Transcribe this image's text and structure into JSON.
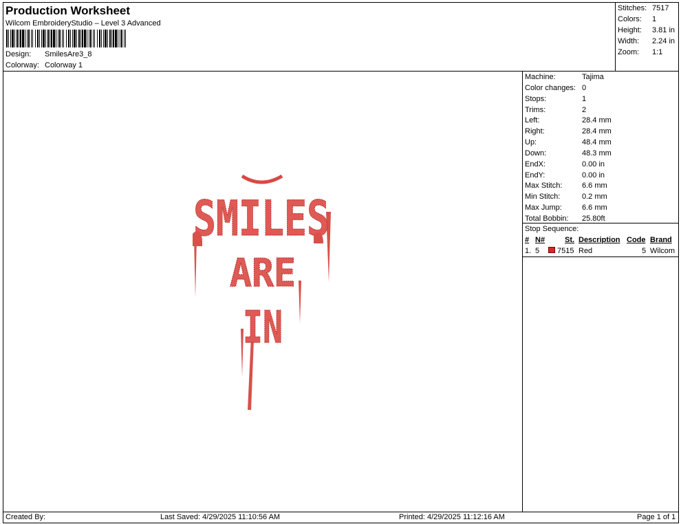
{
  "header": {
    "title": "Production Worksheet",
    "subtitle": "Wilcom EmbroideryStudio – Level 3 Advanced",
    "design_label": "Design:",
    "design_value": "SmilesAre3_8",
    "colorway_label": "Colorway:",
    "colorway_value": "Colorway 1"
  },
  "summary": [
    {
      "label": "Stitches:",
      "value": "7517"
    },
    {
      "label": "Colors:",
      "value": "1"
    },
    {
      "label": "Height:",
      "value": "3.81 in"
    },
    {
      "label": "Width:",
      "value": "2.24 in"
    },
    {
      "label": "Zoom:",
      "value": "1:1"
    }
  ],
  "specs": [
    {
      "label": "Machine:",
      "value": "Tajima"
    },
    {
      "label": "Color changes:",
      "value": "0"
    },
    {
      "label": "Stops:",
      "value": "1"
    },
    {
      "label": "Trims:",
      "value": "2"
    },
    {
      "label": "Left:",
      "value": "28.4 mm"
    },
    {
      "label": "Right:",
      "value": "28.4 mm"
    },
    {
      "label": "Up:",
      "value": "48.4 mm"
    },
    {
      "label": "Down:",
      "value": "48.3 mm"
    },
    {
      "label": "EndX:",
      "value": "0.00 in"
    },
    {
      "label": "EndY:",
      "value": "0.00 in"
    },
    {
      "label": "Max Stitch:",
      "value": "6.6 mm"
    },
    {
      "label": "Min Stitch:",
      "value": "0.2 mm"
    },
    {
      "label": "Max Jump:",
      "value": "6.6 mm"
    },
    {
      "label": "Total Bobbin:",
      "value": "25.80ft"
    }
  ],
  "stop_sequence": {
    "title": "Stop Sequence:",
    "headers": {
      "num": "#",
      "n": "N#",
      "st": "St.",
      "description": "Description",
      "code": "Code",
      "brand": "Brand"
    },
    "rows": [
      {
        "num": "1.",
        "n": "5",
        "st": "7515",
        "description": "Red",
        "code": "5",
        "brand": "Wilcom",
        "color": "#d42a2a"
      }
    ]
  },
  "design_preview": {
    "lines": [
      "SMILES",
      "ARE",
      "IN"
    ],
    "thread_color": "#e05a55",
    "outline_color": "#b8322f"
  },
  "footer": {
    "created_by": "Created By:",
    "last_saved": "Last Saved: 4/29/2025 11:10:56 AM",
    "printed": "Printed: 4/29/2025 11:12:16 AM",
    "page": "Page 1 of 1"
  }
}
